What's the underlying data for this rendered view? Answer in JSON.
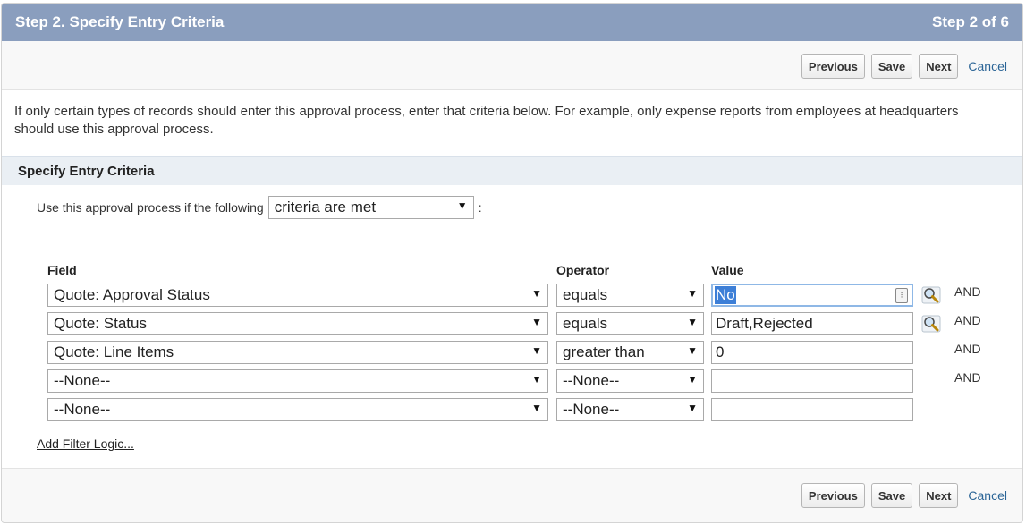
{
  "header": {
    "title": "Step 2. Specify Entry Criteria",
    "step": "Step 2 of 6"
  },
  "buttons": {
    "previous": "Previous",
    "save": "Save",
    "next": "Next",
    "cancel": "Cancel"
  },
  "intro": "If only certain types of records should enter this approval process, enter that criteria below. For example, only expense reports from employees at headquarters should use this approval process.",
  "section": {
    "title": "Specify Entry Criteria"
  },
  "criteria": {
    "prefix": "Use this approval process if the following",
    "selected": "criteria are met",
    "suffix": ":"
  },
  "columns": {
    "field": "Field",
    "operator": "Operator",
    "value": "Value"
  },
  "rows": [
    {
      "field": "Quote: Approval Status",
      "operator": "equals",
      "value": "No",
      "conj": "AND"
    },
    {
      "field": "Quote: Status",
      "operator": "equals",
      "value": "Draft,Rejected",
      "conj": "AND"
    },
    {
      "field": "Quote: Line Items",
      "operator": "greater than",
      "value": "0",
      "conj": "AND"
    },
    {
      "field": "--None--",
      "operator": "--None--",
      "value": "",
      "conj": "AND"
    },
    {
      "field": "--None--",
      "operator": "--None--",
      "value": ""
    }
  ],
  "add_filter_logic": "Add Filter Logic...",
  "icons": {
    "dropdown": "▼",
    "lookup": "lookup-magnifier-icon",
    "picklist_helper": "picklist-helper-icon"
  }
}
